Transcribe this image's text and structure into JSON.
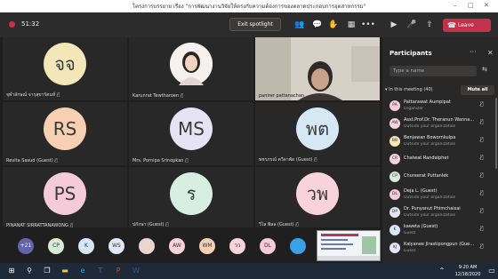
{
  "window": {
    "title": "โครงการบรรยาย เรื่อง \"การพัฒนางานวิจัยให้ตรงกับความต้องการของตลาดประกอบการอุตสาหกรรม\""
  },
  "toolbar": {
    "timer": "51:32",
    "spotlight_label": "Exit spotlight",
    "leave_label": "Leave"
  },
  "tiles": [
    {
      "initials": "จจ",
      "name": "จุฬาลักษณ์ จารุสุขารัตนห์",
      "color": "#f3e7b8",
      "kind": "avatar"
    },
    {
      "initials": "",
      "name": "Karunrat Tewtharoen",
      "color": "#ffffff",
      "kind": "photo"
    },
    {
      "initials": "",
      "name": "panirer pattanachan",
      "color": "#cfc9bf",
      "kind": "video"
    },
    {
      "initials": "RS",
      "name": "Revita Sasud (Guest)",
      "color": "#f7d0b4",
      "kind": "avatar"
    },
    {
      "initials": "MS",
      "name": "Mrs. Pornipa Srinopkan",
      "color": "#e6e3f5",
      "kind": "avatar"
    },
    {
      "initials": "พต",
      "name": "พชรภรณ์ ตวีดาพัด (Guest)",
      "color": "#d7e8f5",
      "kind": "avatar"
    },
    {
      "initials": "PS",
      "name": "PINANAT SIRRATTANAWONG",
      "color": "#f6cbd9",
      "kind": "avatar"
    },
    {
      "initials": "ร",
      "name": "ปกักษา (Guest)",
      "color": "#d7efe2",
      "kind": "avatar"
    },
    {
      "initials": "วพ",
      "name": "วิไล พิลล (Guest)",
      "color": "#f8d2dc",
      "kind": "avatar"
    }
  ],
  "tray": [
    {
      "label": "+21",
      "color": "#6264a7"
    },
    {
      "label": "CP",
      "color": "#d6ecd7"
    },
    {
      "label": "K",
      "color": "#d7e8f5"
    },
    {
      "label": "WS",
      "color": "#e3e6f7"
    },
    {
      "label": "",
      "color": "#e8d6cf"
    },
    {
      "label": "AW",
      "color": "#f8d2dc"
    },
    {
      "label": "WM",
      "color": "#f7d0b4"
    },
    {
      "label": "วว",
      "color": "#f8d2dc"
    },
    {
      "label": "DL",
      "color": "#f6cbd9"
    },
    {
      "label": "",
      "color": "#3aa0e8"
    }
  ],
  "panel": {
    "title": "Participants",
    "search_placeholder": "Type a name",
    "section": "In this meeting (40)",
    "mute_all": "Mute all",
    "participants": [
      {
        "initials": "PA",
        "name": "Pattarawat Aumpipat",
        "sub": "Organizer",
        "color": "#f6cbd9"
      },
      {
        "initials": "AW",
        "name": "Asst.Prof.Dr. Theranun Wanna...",
        "sub": "Outside your organization",
        "color": "#f8d2dc"
      },
      {
        "initials": "BB",
        "name": "Benjawan Bowornkulpa",
        "sub": "Outside your organization",
        "color": "#f3e7b8"
      },
      {
        "initials": "CR",
        "name": "Chaiwat Randaiphet",
        "sub": "",
        "color": "#f8d2dc"
      },
      {
        "initials": "CP",
        "name": "Chureerat Puttanlek",
        "sub": "",
        "color": "#d6ecd7"
      },
      {
        "initials": "DL",
        "name": "Deja L. (Guest)",
        "sub": "Outside your organization",
        "color": "#f6cbd9"
      },
      {
        "initials": "DP",
        "name": "Dr. Punyanut Phimchaisai",
        "sub": "Outside your organization",
        "color": "#e3e6f7"
      },
      {
        "initials": "K",
        "name": "kaweta (Guest)",
        "sub": "Guest",
        "color": "#d7e8f5"
      },
      {
        "initials": "KJ",
        "name": "Kalyanee Jirastipongpun (Gue...",
        "sub": "Guest",
        "color": "#e3e6f7"
      }
    ]
  },
  "taskbar": {
    "time": "9:20 AM",
    "date": "12/18/2020"
  }
}
